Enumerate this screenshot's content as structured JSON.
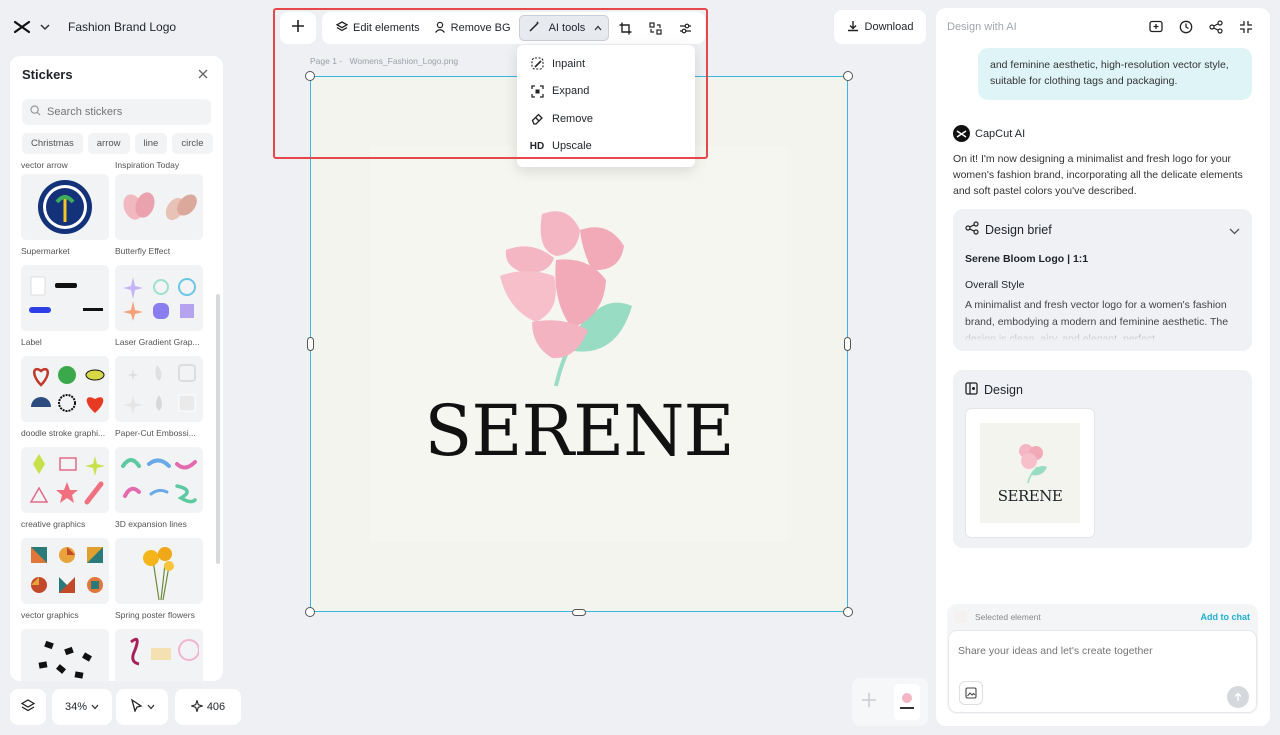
{
  "brand": {
    "title": "Fashion Brand Logo"
  },
  "stickers": {
    "title": "Stickers",
    "search_placeholder": "Search stickers",
    "chips": [
      "Christmas",
      "arrow",
      "line",
      "circle"
    ],
    "top_labels": [
      "vector arrow",
      "Inspiration Today"
    ],
    "items": [
      "Supermarket",
      "Butterfly Effect",
      "Label",
      "Laser Gradient Grap...",
      "doodle stroke graphi...",
      "Paper-Cut Embossi...",
      "creative graphics",
      "3D expansion lines",
      "vector graphics",
      "Spring poster flowers"
    ]
  },
  "bottom_left": {
    "zoom": "34%",
    "credits": "406"
  },
  "toolbar": {
    "edit_elements": "Edit elements",
    "remove_bg": "Remove BG",
    "ai_tools": "AI tools"
  },
  "ai_menu": {
    "items": [
      {
        "label": "Inpaint",
        "icon": "inpaint-icon"
      },
      {
        "label": "Expand",
        "icon": "expand-icon"
      },
      {
        "label": "Remove",
        "icon": "eraser-icon"
      },
      {
        "label": "Upscale",
        "icon": "HD"
      }
    ]
  },
  "download": {
    "label": "Download"
  },
  "canvas": {
    "page_label": "Page 1 -",
    "file_name": "Womens_Fashion_Logo.png",
    "logo_text": "SERENE"
  },
  "right_panel": {
    "title": "Design with AI",
    "user_message": "and feminine aesthetic, high-resolution vector style, suitable for clothing tags and packaging.",
    "ai_name": "CapCut AI",
    "ai_message": "On it! I'm now designing a minimalist and fresh logo for your women's fashion brand, incorporating all the delicate elements and soft pastel colors you've described.",
    "brief": {
      "title": "Design brief",
      "subtitle": "Serene Bloom Logo | 1:1",
      "heading": "Overall Style",
      "text": "A minimalist and fresh vector logo for a women's fashion brand, embodying a modern and feminine aesthetic. The design is clean, airy, and elegant, perfect"
    },
    "design": {
      "title": "Design",
      "thumb_text": "SERENE"
    },
    "chat": {
      "selected_element": "Selected element",
      "add_to_chat": "Add to chat",
      "placeholder": "Share your ideas and let's create together"
    }
  },
  "colors": {
    "selection": "#3bb6e0",
    "highlight": "#e5474b",
    "petal": "#f4b6c2",
    "leaf": "#98dcc3",
    "accent": "#1fb0d6"
  }
}
